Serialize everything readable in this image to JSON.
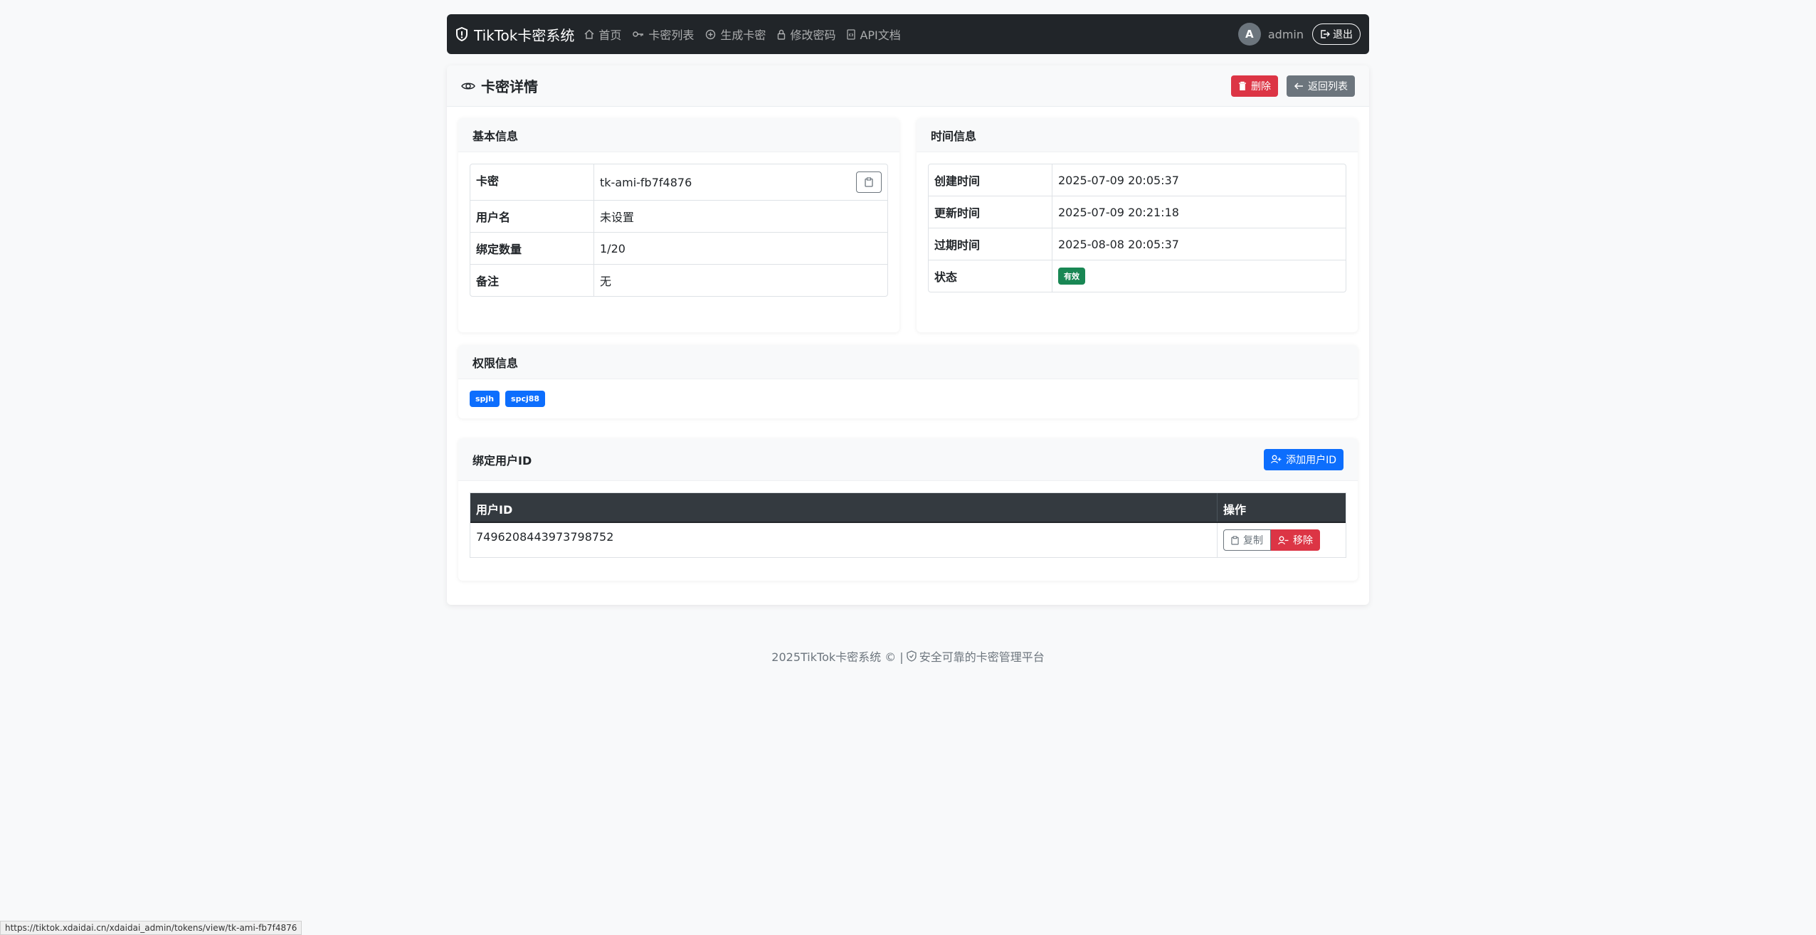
{
  "navbar": {
    "brand": "TikTok卡密系统",
    "links": [
      {
        "label": "首页",
        "icon": "house-icon"
      },
      {
        "label": "卡密列表",
        "icon": "key-icon"
      },
      {
        "label": "生成卡密",
        "icon": "plus-circle-icon"
      },
      {
        "label": "修改密码",
        "icon": "lock-icon"
      },
      {
        "label": "API文档",
        "icon": "file-code-icon"
      }
    ],
    "avatar_letter": "A",
    "username": "admin",
    "logout_label": "退出"
  },
  "page": {
    "title": "卡密详情",
    "delete_label": "删除",
    "back_label": "返回列表"
  },
  "basic_info": {
    "title": "基本信息",
    "rows": [
      {
        "key": "卡密",
        "value": "tk-ami-fb7f4876"
      },
      {
        "key": "用户名",
        "value": "未设置"
      },
      {
        "key": "绑定数量",
        "value": "1/20"
      },
      {
        "key": "备注",
        "value": "无"
      }
    ]
  },
  "time_info": {
    "title": "时间信息",
    "rows": [
      {
        "key": "创建时间",
        "value": "2025-07-09 20:05:37"
      },
      {
        "key": "更新时间",
        "value": "2025-07-09 20:21:18"
      },
      {
        "key": "过期时间",
        "value": "2025-08-08 20:05:37"
      },
      {
        "key": "状态",
        "value": "有效"
      }
    ]
  },
  "permissions": {
    "title": "权限信息",
    "badges": [
      "spjh",
      "spcj88"
    ]
  },
  "bindings": {
    "title": "绑定用户ID",
    "add_label": "添加用户ID",
    "columns": [
      "用户ID",
      "操作"
    ],
    "rows": [
      {
        "user_id": "7496208443973798752",
        "copy_label": "复制",
        "remove_label": "移除"
      }
    ]
  },
  "footer": {
    "text_left": "2025TikTok卡密系统 © |",
    "text_right": "安全可靠的卡密管理平台"
  },
  "status_url": "https://tiktok.xdaidai.cn/xdaidai_admin/tokens/view/tk-ami-fb7f4876"
}
